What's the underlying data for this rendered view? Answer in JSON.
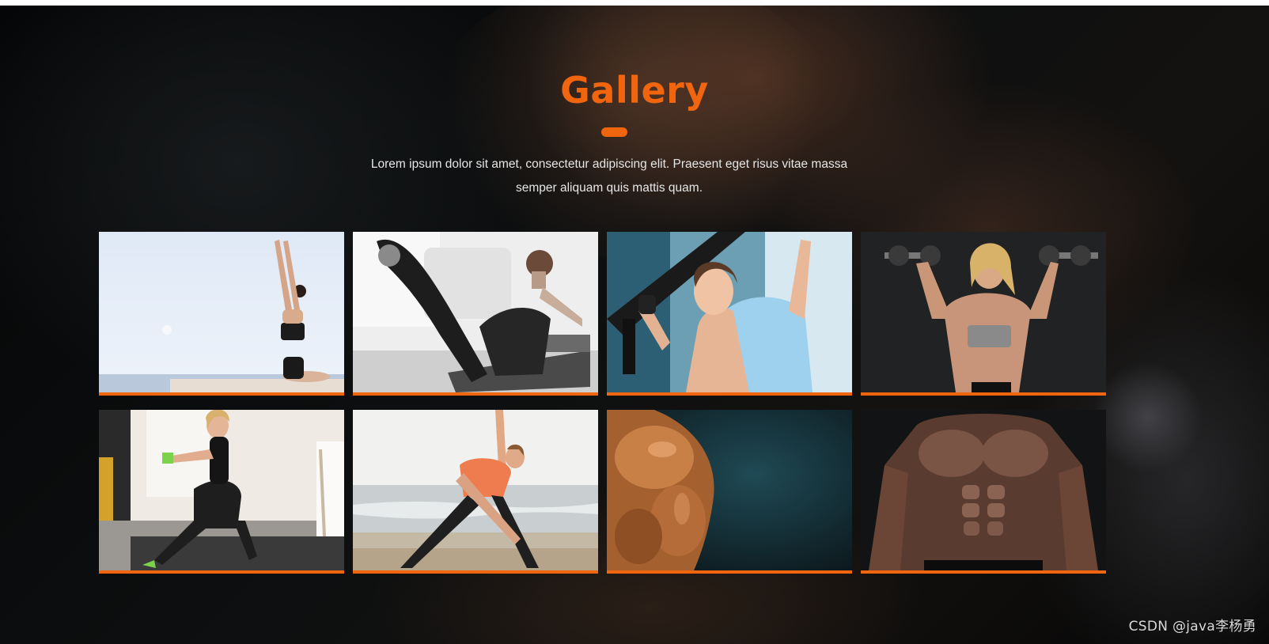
{
  "gallery": {
    "title": "Gallery",
    "subtitle_line1": "Lorem ipsum dolor sit amet, consectetur adipiscing elit. Praesent eget risus vitae massa",
    "subtitle_line2": "semper aliquam quis mattis quam.",
    "accent_color": "#f2650f",
    "photos": [
      {
        "icon": "yoga-seaside-photo"
      },
      {
        "icon": "pilates-reformer-photo"
      },
      {
        "icon": "gym-pulldown-photo"
      },
      {
        "icon": "dumbbell-press-photo"
      },
      {
        "icon": "kettlebell-lunge-photo"
      },
      {
        "icon": "beach-yoga-stretch-photo"
      },
      {
        "icon": "bodybuilder-arm-photo"
      },
      {
        "icon": "bodybuilder-torso-photo"
      }
    ]
  },
  "watermark": "CSDN @java李杨勇"
}
